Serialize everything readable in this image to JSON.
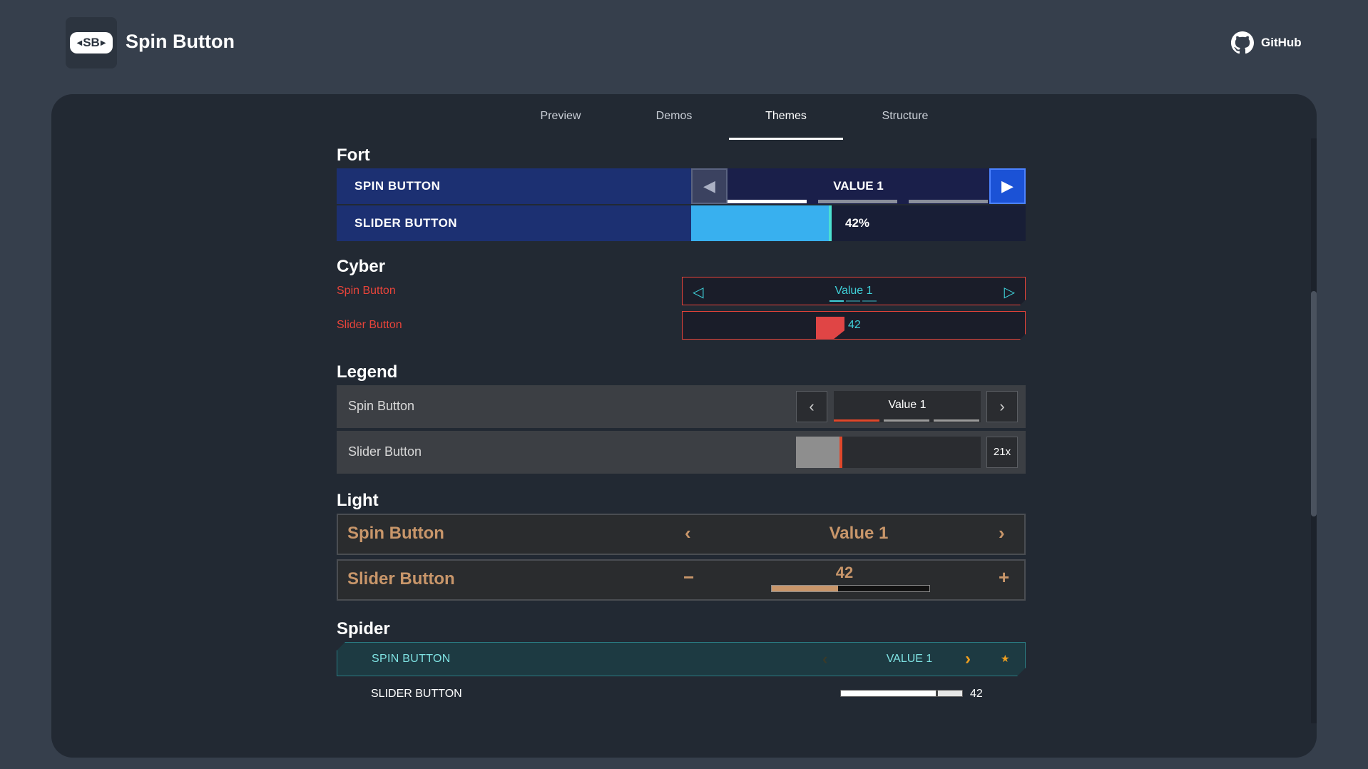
{
  "header": {
    "logo_text": "SB",
    "title": "Spin Button",
    "github_label": "GitHub"
  },
  "tabs": [
    {
      "label": "Preview",
      "active": false
    },
    {
      "label": "Demos",
      "active": false
    },
    {
      "label": "Themes",
      "active": true
    },
    {
      "label": "Structure",
      "active": false
    }
  ],
  "themes": {
    "fort": {
      "title": "Fort",
      "spin_label": "SPIN BUTTON",
      "spin_value": "VALUE 1",
      "slider_label": "SLIDER BUTTON",
      "slider_value": "42%",
      "slider_fraction": 0.42,
      "indicator_active_index": 0,
      "indicator_count": 3
    },
    "cyber": {
      "title": "Cyber",
      "spin_label": "Spin Button",
      "spin_value": "Value 1",
      "slider_label": "Slider Button",
      "slider_value": "42",
      "slider_fraction": 0.42
    },
    "legend": {
      "title": "Legend",
      "spin_label": "Spin Button",
      "spin_value": "Value 1",
      "slider_label": "Slider Button",
      "slider_value": "21x",
      "slider_fraction": 0.25
    },
    "light": {
      "title": "Light",
      "spin_label": "Spin Button",
      "spin_value": "Value 1",
      "slider_label": "Slider Button",
      "slider_value": "42",
      "slider_fraction": 0.42
    },
    "spider": {
      "title": "Spider",
      "spin_label": "SPIN BUTTON",
      "spin_value": "VALUE 1",
      "slider_label": "SLIDER BUTTON",
      "slider_value": "42",
      "slider_fraction": 0.8
    }
  },
  "icons": {
    "prev": "chevron-left-icon",
    "next": "chevron-right-icon",
    "github": "github-icon",
    "star": "star-icon",
    "minus": "minus-icon",
    "plus": "plus-icon"
  },
  "colors": {
    "page_bg": "#363f4c",
    "card_bg": "#222933",
    "fort_blue": "#1c3072",
    "fort_accent": "#38b0ef",
    "cyber_red": "#e8443a",
    "cyber_cyan": "#3fd0d8",
    "legend_orange": "#e0472a",
    "light_tan": "#c8966a",
    "spider_teal": "#7fe3e3",
    "spider_gold": "#f0a020"
  }
}
